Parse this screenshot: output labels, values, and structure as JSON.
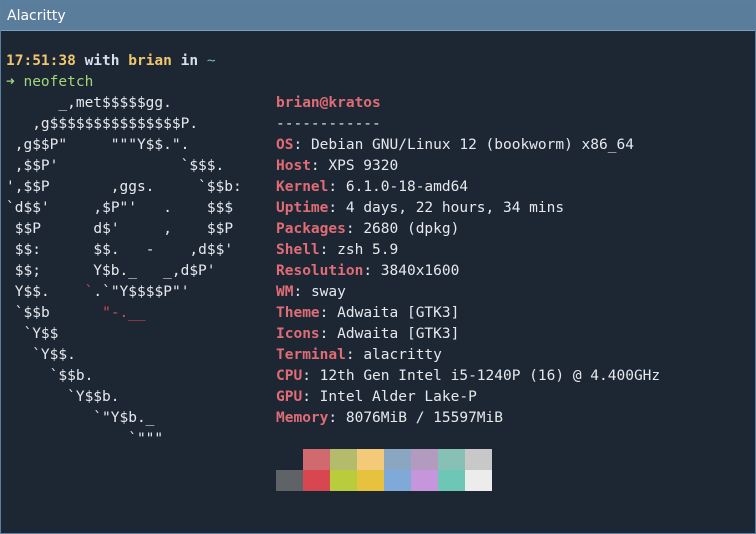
{
  "window": {
    "title": "Alacritty"
  },
  "prompt": {
    "time": "17:51:38",
    "with": "with",
    "user": "brian",
    "in": "in",
    "dir": "~"
  },
  "command": {
    "arrow": "➜",
    "text": "neofetch"
  },
  "logo_lines": [
    "      _,met$$$$$gg.",
    "   ,g$$$$$$$$$$$$$$$P.",
    " ,g$$P\"     \"\"\"Y$$.\".",
    " ,$$P'              `$$$.",
    "',$$P       ,ggs.     `$$b:",
    "`d$$'     ,$P\"'   .    $$$",
    " $$P      d$'     ,    $$P",
    " $$:      $$.   -    ,d$$'",
    " $$;      Y$b._   _,d$P'",
    " Y$$.    `.`\"Y$$$$P\"'",
    " `$$b      \"-.__",
    "  `Y$$",
    "   `Y$$.",
    "     `$$b.",
    "       `Y$$b.",
    "          `\"Y$b._",
    "              `\"\"\""
  ],
  "info": {
    "header": "brian@kratos",
    "separator": "------------",
    "rows": [
      {
        "key": "OS",
        "value": "Debian GNU/Linux 12 (bookworm) x86_64"
      },
      {
        "key": "Host",
        "value": "XPS 9320"
      },
      {
        "key": "Kernel",
        "value": "6.1.0-18-amd64"
      },
      {
        "key": "Uptime",
        "value": "4 days, 22 hours, 34 mins"
      },
      {
        "key": "Packages",
        "value": "2680 (dpkg)"
      },
      {
        "key": "Shell",
        "value": "zsh 5.9"
      },
      {
        "key": "Resolution",
        "value": "3840x1600"
      },
      {
        "key": "WM",
        "value": "sway"
      },
      {
        "key": "Theme",
        "value": "Adwaita [GTK3]"
      },
      {
        "key": "Icons",
        "value": "Adwaita [GTK3]"
      },
      {
        "key": "Terminal",
        "value": "alacritty"
      },
      {
        "key": "CPU",
        "value": "12th Gen Intel i5-1240P (16) @ 4.400GHz"
      },
      {
        "key": "GPU",
        "value": "Intel Alder Lake-P"
      },
      {
        "key": "Memory",
        "value": "8076MiB / 15597MiB"
      }
    ]
  },
  "palette": {
    "row1": [
      "#1d2734",
      "#d06a6f",
      "#b4bb6b",
      "#f3c97a",
      "#8aa6c1",
      "#b39bc0",
      "#87c1b6",
      "#c8c8c8"
    ],
    "row2": [
      "#5f6266",
      "#d8464f",
      "#b9cd3c",
      "#e7c23f",
      "#7fa9d8",
      "#c596dc",
      "#6ec6b6",
      "#ececec"
    ]
  },
  "colors": {
    "titlebar": "#5b7d9c",
    "background": "#1d2734",
    "accent_red": "#e06c75",
    "prompt_yellow": "#f0c66e",
    "command_green": "#a3d67a"
  }
}
